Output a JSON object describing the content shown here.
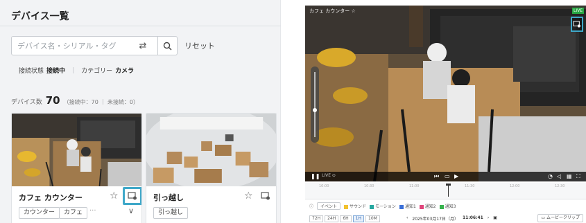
{
  "left": {
    "title": "デバイス一覧",
    "search": {
      "placeholder": "デバイス名・シリアル・タグ",
      "value": ""
    },
    "reset_label": "リセット",
    "filters": {
      "status_label": "接続状態",
      "status_value": "接続中",
      "category_label": "カテゴリー",
      "category_value": "カメラ"
    },
    "device_count": {
      "label": "デバイス数",
      "value": "70",
      "detail": "（接続中：70 ｜ 未接続：0）"
    },
    "devices": [
      {
        "name": "カフェ カウンター",
        "tags": [
          "カウンター",
          "カフェ"
        ],
        "more": "···"
      },
      {
        "name": "引っ越し",
        "tags": [
          "引っ越し"
        ]
      }
    ]
  },
  "right": {
    "video_title": "カフェ カウンター",
    "live_badge": "LIVE",
    "live_label": "LIVE ⊙",
    "timeline_labels": [
      "10:00",
      "10:30",
      "11:00",
      "11:30",
      "12:00",
      "12:30"
    ],
    "legend": {
      "event_button": "イベント",
      "items": [
        {
          "label": "サウンド",
          "color": "#f2c230"
        },
        {
          "label": "モーション",
          "color": "#27a8a0"
        },
        {
          "label": "通知1",
          "color": "#3a6fd8"
        },
        {
          "label": "通知2",
          "color": "#e0457b"
        },
        {
          "label": "通知3",
          "color": "#37b24d"
        }
      ]
    },
    "ranges": [
      "72H",
      "24H",
      "6H",
      "1H",
      "10M"
    ],
    "active_range": "1H",
    "date_text": "2025年03月17日（月）",
    "time_text": "11:06:41",
    "movie_clip_label": "ムービークリップ"
  }
}
